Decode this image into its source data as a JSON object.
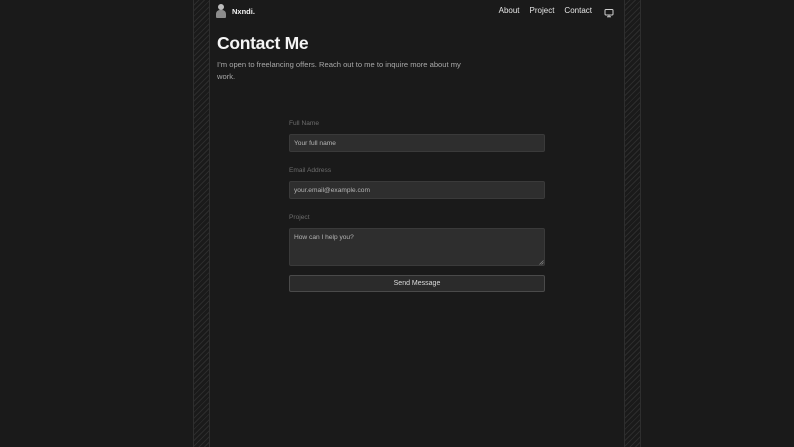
{
  "nav": {
    "brand": "Nxndi.",
    "links": [
      "About",
      "Project",
      "Contact"
    ],
    "theme_icon": "monitor-icon",
    "avatar_icon": "avatar-icon"
  },
  "hero": {
    "title": "Contact Me",
    "subtitle": "I’m open to freelancing offers. Reach out to me to inquire more about my work."
  },
  "form": {
    "name_label": "Full Name",
    "name_placeholder": "Your full name",
    "email_label": "Email Address",
    "email_placeholder": "your.email@example.com",
    "project_label": "Project",
    "project_placeholder": "How can I help you?",
    "submit_label": "Send Message"
  },
  "colors": {
    "background": "#1a1a1a",
    "field": "#2e2e2e",
    "text": "#e6e6e6"
  }
}
